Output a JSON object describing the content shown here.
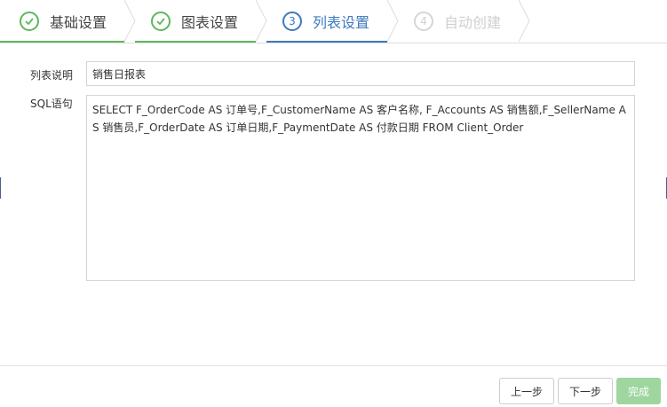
{
  "wizard": {
    "steps": [
      {
        "num": "1",
        "label": "基础设置",
        "state": "done"
      },
      {
        "num": "2",
        "label": "图表设置",
        "state": "done"
      },
      {
        "num": "3",
        "label": "列表设置",
        "state": "active"
      },
      {
        "num": "4",
        "label": "自动创建",
        "state": "disabled"
      }
    ]
  },
  "form": {
    "description_label": "列表说明",
    "description_value": "销售日报表",
    "sql_label": "SQL语句",
    "sql_value": "SELECT F_OrderCode AS 订单号,F_CustomerName AS 客户名称, F_Accounts AS 销售额,F_SellerName AS 销售员,F_OrderDate AS 订单日期,F_PaymentDate AS 付款日期 FROM Client_Order"
  },
  "footer": {
    "prev_label": "上一步",
    "next_label": "下一步",
    "finish_label": "完成"
  },
  "colors": {
    "done": "#5cb85c",
    "active": "#3c7bbd",
    "disabled": "#cfcfcf",
    "finish_button": "#9fd69f"
  }
}
